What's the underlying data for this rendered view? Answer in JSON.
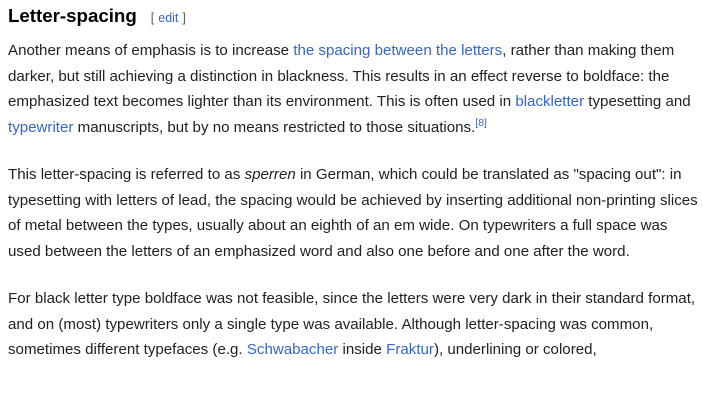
{
  "section": {
    "title": "Letter-spacing",
    "edit_open": "[",
    "edit_label": "edit",
    "edit_close": "]"
  },
  "p1": {
    "t1": "Another means of emphasis is to increase ",
    "link1": "the spacing between the letters",
    "t2": ", rather than making them darker, but still achieving a distinction in blackness. This results in an effect reverse to boldface: the emphasized text becomes lighter than its environment. This is often used in ",
    "link2": "blackletter",
    "t3": " typesetting and ",
    "link3": "typewriter",
    "t4": " manuscripts, but by no means restricted to those situations.",
    "ref": "[8]"
  },
  "p2": {
    "t1": "This letter-spacing is referred to as ",
    "em": "sperren",
    "t2": " in German, which could be translated as \"spacing out\": in typesetting with letters of lead, the spacing would be achieved by inserting additional non-printing slices of metal between the types, usually about an eighth of an em wide. On typewriters a full space was used between the letters of an emphasized word and also one before and one after the word."
  },
  "p3": {
    "t1": "For black letter type boldface was not feasible, since the letters were very dark in their standard format, and on (most) typewriters only a single type was available. Although letter-spacing was common, sometimes different typefaces (e.g. ",
    "link1": "Schwabacher",
    "t2": " inside ",
    "link2": "Fraktur",
    "t3": "), underlining or colored,"
  }
}
